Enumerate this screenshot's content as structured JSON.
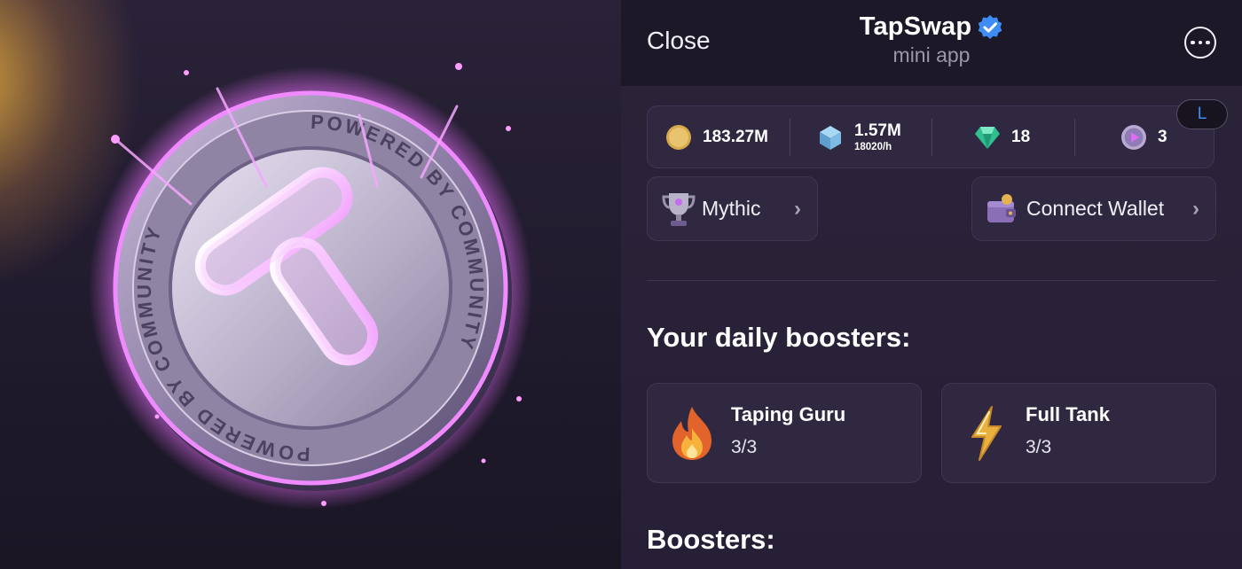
{
  "coin": {
    "ring_text": "POWERED BY COMMUNITY"
  },
  "header": {
    "close_label": "Close",
    "title": "TapSwap",
    "subtitle": "mini app"
  },
  "stats": {
    "coins": "183.27M",
    "shares": "1.57M",
    "shares_rate": "18020/h",
    "gems": "18",
    "tickets": "3",
    "level_badge": "L"
  },
  "actions": {
    "league_label": "Mythic",
    "wallet_label": "Connect Wallet"
  },
  "daily": {
    "title": "Your daily boosters:",
    "items": [
      {
        "name": "Taping Guru",
        "count": "3/3",
        "icon": "fire-icon"
      },
      {
        "name": "Full Tank",
        "count": "3/3",
        "icon": "lightning-icon"
      }
    ]
  },
  "boosters": {
    "title": "Boosters:"
  },
  "colors": {
    "accent_blue": "#3e8cf5",
    "coin_glow": "#e46cf5",
    "panel": "#2f2840"
  }
}
